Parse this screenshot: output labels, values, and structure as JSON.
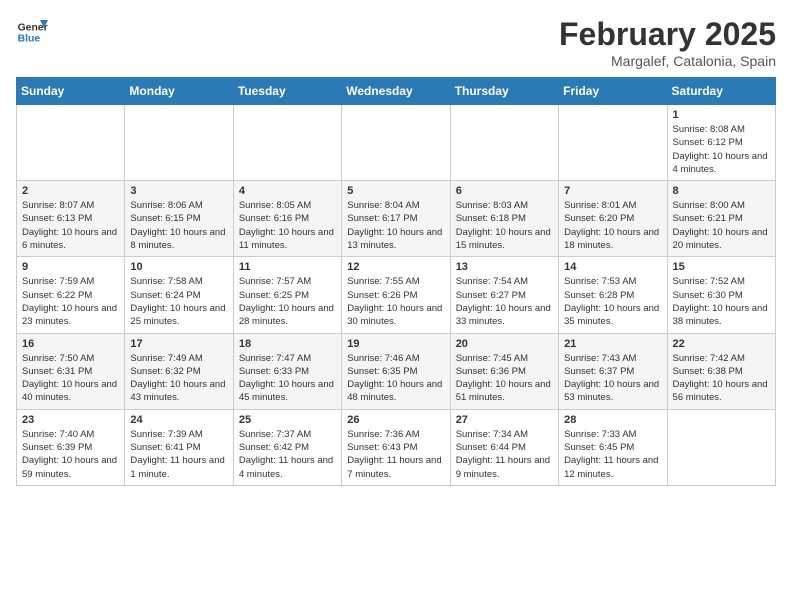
{
  "logo": {
    "general": "General",
    "blue": "Blue"
  },
  "title": "February 2025",
  "location": "Margalef, Catalonia, Spain",
  "weekdays": [
    "Sunday",
    "Monday",
    "Tuesday",
    "Wednesday",
    "Thursday",
    "Friday",
    "Saturday"
  ],
  "weeks": [
    [
      null,
      null,
      null,
      null,
      null,
      null,
      {
        "day": "1",
        "sunrise": "8:08 AM",
        "sunset": "6:12 PM",
        "daylight": "10 hours and 4 minutes."
      }
    ],
    [
      {
        "day": "2",
        "sunrise": "8:07 AM",
        "sunset": "6:13 PM",
        "daylight": "10 hours and 6 minutes."
      },
      {
        "day": "3",
        "sunrise": "8:06 AM",
        "sunset": "6:15 PM",
        "daylight": "10 hours and 8 minutes."
      },
      {
        "day": "4",
        "sunrise": "8:05 AM",
        "sunset": "6:16 PM",
        "daylight": "10 hours and 11 minutes."
      },
      {
        "day": "5",
        "sunrise": "8:04 AM",
        "sunset": "6:17 PM",
        "daylight": "10 hours and 13 minutes."
      },
      {
        "day": "6",
        "sunrise": "8:03 AM",
        "sunset": "6:18 PM",
        "daylight": "10 hours and 15 minutes."
      },
      {
        "day": "7",
        "sunrise": "8:01 AM",
        "sunset": "6:20 PM",
        "daylight": "10 hours and 18 minutes."
      },
      {
        "day": "8",
        "sunrise": "8:00 AM",
        "sunset": "6:21 PM",
        "daylight": "10 hours and 20 minutes."
      }
    ],
    [
      {
        "day": "9",
        "sunrise": "7:59 AM",
        "sunset": "6:22 PM",
        "daylight": "10 hours and 23 minutes."
      },
      {
        "day": "10",
        "sunrise": "7:58 AM",
        "sunset": "6:24 PM",
        "daylight": "10 hours and 25 minutes."
      },
      {
        "day": "11",
        "sunrise": "7:57 AM",
        "sunset": "6:25 PM",
        "daylight": "10 hours and 28 minutes."
      },
      {
        "day": "12",
        "sunrise": "7:55 AM",
        "sunset": "6:26 PM",
        "daylight": "10 hours and 30 minutes."
      },
      {
        "day": "13",
        "sunrise": "7:54 AM",
        "sunset": "6:27 PM",
        "daylight": "10 hours and 33 minutes."
      },
      {
        "day": "14",
        "sunrise": "7:53 AM",
        "sunset": "6:28 PM",
        "daylight": "10 hours and 35 minutes."
      },
      {
        "day": "15",
        "sunrise": "7:52 AM",
        "sunset": "6:30 PM",
        "daylight": "10 hours and 38 minutes."
      }
    ],
    [
      {
        "day": "16",
        "sunrise": "7:50 AM",
        "sunset": "6:31 PM",
        "daylight": "10 hours and 40 minutes."
      },
      {
        "day": "17",
        "sunrise": "7:49 AM",
        "sunset": "6:32 PM",
        "daylight": "10 hours and 43 minutes."
      },
      {
        "day": "18",
        "sunrise": "7:47 AM",
        "sunset": "6:33 PM",
        "daylight": "10 hours and 45 minutes."
      },
      {
        "day": "19",
        "sunrise": "7:46 AM",
        "sunset": "6:35 PM",
        "daylight": "10 hours and 48 minutes."
      },
      {
        "day": "20",
        "sunrise": "7:45 AM",
        "sunset": "6:36 PM",
        "daylight": "10 hours and 51 minutes."
      },
      {
        "day": "21",
        "sunrise": "7:43 AM",
        "sunset": "6:37 PM",
        "daylight": "10 hours and 53 minutes."
      },
      {
        "day": "22",
        "sunrise": "7:42 AM",
        "sunset": "6:38 PM",
        "daylight": "10 hours and 56 minutes."
      }
    ],
    [
      {
        "day": "23",
        "sunrise": "7:40 AM",
        "sunset": "6:39 PM",
        "daylight": "10 hours and 59 minutes."
      },
      {
        "day": "24",
        "sunrise": "7:39 AM",
        "sunset": "6:41 PM",
        "daylight": "11 hours and 1 minute."
      },
      {
        "day": "25",
        "sunrise": "7:37 AM",
        "sunset": "6:42 PM",
        "daylight": "11 hours and 4 minutes."
      },
      {
        "day": "26",
        "sunrise": "7:36 AM",
        "sunset": "6:43 PM",
        "daylight": "11 hours and 7 minutes."
      },
      {
        "day": "27",
        "sunrise": "7:34 AM",
        "sunset": "6:44 PM",
        "daylight": "11 hours and 9 minutes."
      },
      {
        "day": "28",
        "sunrise": "7:33 AM",
        "sunset": "6:45 PM",
        "daylight": "11 hours and 12 minutes."
      },
      null
    ]
  ]
}
